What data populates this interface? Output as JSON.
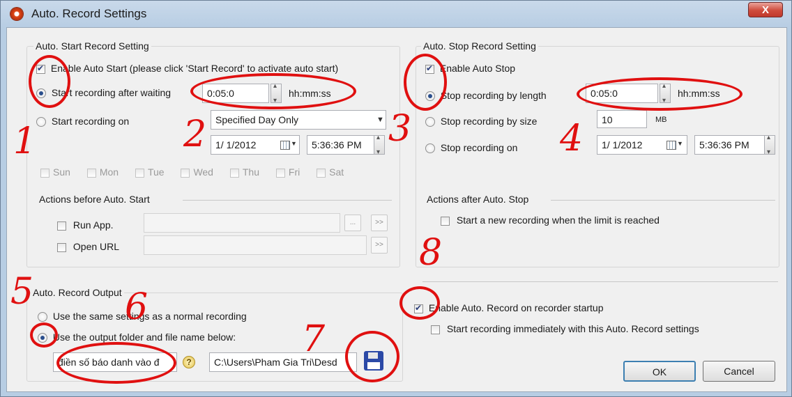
{
  "window": {
    "title": "Auto. Record Settings",
    "close_label": "X"
  },
  "start_group": {
    "label": "Auto. Start Record Setting",
    "enable_auto_start": "Enable Auto Start (please click 'Start Record' to activate auto start)",
    "after_waiting_label": "Start recording after waiting",
    "wait_value": "0:05:0",
    "wait_unit": "hh:mm:ss",
    "recording_on_label": "Start recording on",
    "day_mode": "Specified Day Only",
    "date": "1/ 1/2012",
    "time": "5:36:36 PM",
    "days": [
      "Sun",
      "Mon",
      "Tue",
      "Wed",
      "Thu",
      "Fri",
      "Sat"
    ],
    "actions_label": "Actions before Auto. Start",
    "run_app_label": "Run App.",
    "open_url_label": "Open URL",
    "browse_label": "...",
    "go_label": ">>"
  },
  "stop_group": {
    "label": "Auto. Stop Record Setting",
    "enable_auto_stop": "Enable Auto Stop",
    "by_length_label": "Stop recording by length",
    "length_value": "0:05:0",
    "length_unit": "hh:mm:ss",
    "by_size_label": "Stop recording by size",
    "size_value": "10",
    "size_unit": "MB",
    "on_label": "Stop recording on",
    "date": "1/ 1/2012",
    "time": "5:36:36 PM",
    "actions_label": "Actions after Auto. Stop",
    "new_recording_label": "Start a new recording when the limit is reached"
  },
  "output_group": {
    "label": "Auto. Record Output",
    "same_settings_label": "Use the same settings as a normal recording",
    "output_folder_label": "Use the output folder and file name below:",
    "file_name_value": "điền số báo danh vào đ",
    "path_value": "C:\\Users\\Pham Gia Tri\\Desd"
  },
  "startup": {
    "enable_startup_label": "Enable Auto. Record on recorder startup",
    "start_immediately_label": "Start recording immediately with this Auto. Record settings"
  },
  "buttons": {
    "ok": "OK",
    "cancel": "Cancel"
  },
  "annotations": [
    "1",
    "2",
    "3",
    "4",
    "5",
    "6",
    "7",
    "8"
  ]
}
